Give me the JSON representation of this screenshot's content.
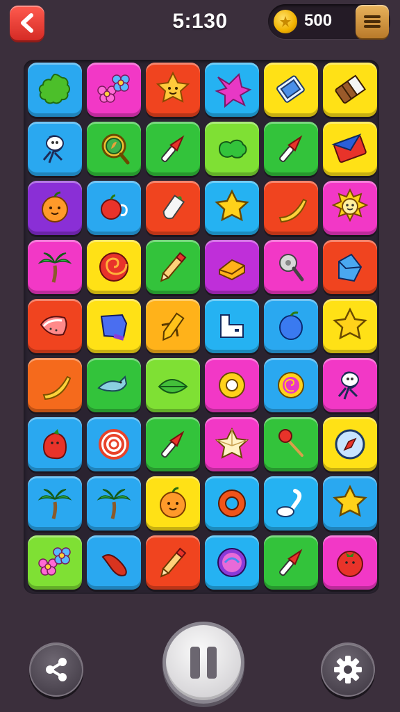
{
  "header": {
    "timer": "5:130",
    "coins": "500",
    "back_icon": "chevron-left-icon",
    "menu_icon": "hamburger-menu-icon",
    "coin_icon": "coin-icon"
  },
  "board": {
    "rows": 9,
    "cols": 6,
    "tiles": [
      {
        "color": "#2aa8f0",
        "icon": "green-bush"
      },
      {
        "color": "#f238c6",
        "icon": "flowers"
      },
      {
        "color": "#f0441f",
        "icon": "smiling-star"
      },
      {
        "color": "#25b2f2",
        "icon": "pink-splat"
      },
      {
        "color": "#ffe116",
        "icon": "blue-book"
      },
      {
        "color": "#ffe116",
        "icon": "chocolate-bar"
      },
      {
        "color": "#2aa8f0",
        "icon": "ghost-puppet"
      },
      {
        "color": "#33c33b",
        "icon": "magnifier-leaf"
      },
      {
        "color": "#33c33b",
        "icon": "paintbrush"
      },
      {
        "color": "#7fe034",
        "icon": "green-leaf-blob"
      },
      {
        "color": "#33c33b",
        "icon": "paintbrush"
      },
      {
        "color": "#ffe116",
        "icon": "red-envelope"
      },
      {
        "color": "#8a2fd6",
        "icon": "orange-face"
      },
      {
        "color": "#2aa8f0",
        "icon": "tomato-cup"
      },
      {
        "color": "#f0441f",
        "icon": "white-pepper"
      },
      {
        "color": "#25b2f2",
        "icon": "yellow-star"
      },
      {
        "color": "#f0441f",
        "icon": "banana"
      },
      {
        "color": "#f238c6",
        "icon": "smiling-sun"
      },
      {
        "color": "#f238c6",
        "icon": "palm-tree"
      },
      {
        "color": "#ffe116",
        "icon": "swirl-candy"
      },
      {
        "color": "#33c33b",
        "icon": "pencil"
      },
      {
        "color": "#bf2fd9",
        "icon": "cheese-block"
      },
      {
        "color": "#f238c6",
        "icon": "pizza-cutter"
      },
      {
        "color": "#f0441f",
        "icon": "blue-bag"
      },
      {
        "color": "#f0441f",
        "icon": "watermelon-slice"
      },
      {
        "color": "#ffe116",
        "icon": "blue-cloth"
      },
      {
        "color": "#ffb21a",
        "icon": "rocket-pen"
      },
      {
        "color": "#25b2f2",
        "icon": "white-block"
      },
      {
        "color": "#2aa8f0",
        "icon": "blue-fruit"
      },
      {
        "color": "#ffe116",
        "icon": "yellow-star"
      },
      {
        "color": "#f56a1c",
        "icon": "banana"
      },
      {
        "color": "#33c33b",
        "icon": "bird"
      },
      {
        "color": "#7fe034",
        "icon": "green-leaf"
      },
      {
        "color": "#f238c6",
        "icon": "yellow-ring"
      },
      {
        "color": "#2aa8f0",
        "icon": "lollipop-swirl"
      },
      {
        "color": "#f238c6",
        "icon": "ghost-puppet"
      },
      {
        "color": "#2aa8f0",
        "icon": "red-fruit"
      },
      {
        "color": "#2aa8f0",
        "icon": "target-rings"
      },
      {
        "color": "#33c33b",
        "icon": "paintbrush"
      },
      {
        "color": "#f238c6",
        "icon": "origami-star"
      },
      {
        "color": "#33c33b",
        "icon": "lollipop-stick"
      },
      {
        "color": "#ffe116",
        "icon": "compass"
      },
      {
        "color": "#2aa8f0",
        "icon": "palm-tree"
      },
      {
        "color": "#2aa8f0",
        "icon": "palm-tree"
      },
      {
        "color": "#ffe116",
        "icon": "orange-face"
      },
      {
        "color": "#25b2f2",
        "icon": "orange-ring"
      },
      {
        "color": "#25b2f2",
        "icon": "white-hook"
      },
      {
        "color": "#2aa8f0",
        "icon": "yellow-star"
      },
      {
        "color": "#7fe034",
        "icon": "flowers"
      },
      {
        "color": "#2aa8f0",
        "icon": "red-pepper"
      },
      {
        "color": "#f0441f",
        "icon": "pencil"
      },
      {
        "color": "#25b2f2",
        "icon": "purple-orb"
      },
      {
        "color": "#33c33b",
        "icon": "paintbrush"
      },
      {
        "color": "#f238c6",
        "icon": "tomato"
      }
    ]
  },
  "footer": {
    "share_icon": "share-icon",
    "pause_icon": "pause-icon",
    "settings_icon": "gear-icon"
  }
}
